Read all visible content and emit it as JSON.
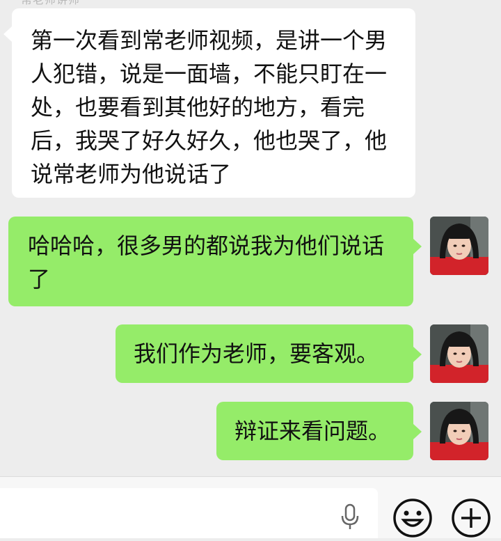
{
  "chat": {
    "sender_name": "常老师讲师",
    "messages": [
      {
        "direction": "incoming",
        "text": "第一次看到常老师视频，是讲一个男人犯错，说是一面墙，不能只盯在一处，也要看到其他好的地方，看完后，我哭了好久好久，他也哭了，他说常老师为他说话了"
      },
      {
        "direction": "outgoing",
        "text": "哈哈哈，很多男的都说我为他们说话了"
      },
      {
        "direction": "outgoing",
        "text": "我们作为老师，要客观。"
      },
      {
        "direction": "outgoing",
        "text": "辩证来看问题。"
      }
    ]
  },
  "input_bar": {
    "icons": [
      "microphone-icon",
      "emoji-icon",
      "plus-icon"
    ],
    "colors": {
      "bubble_outgoing": "#95ec69",
      "bubble_incoming": "#ffffff",
      "background": "#ededed"
    }
  }
}
